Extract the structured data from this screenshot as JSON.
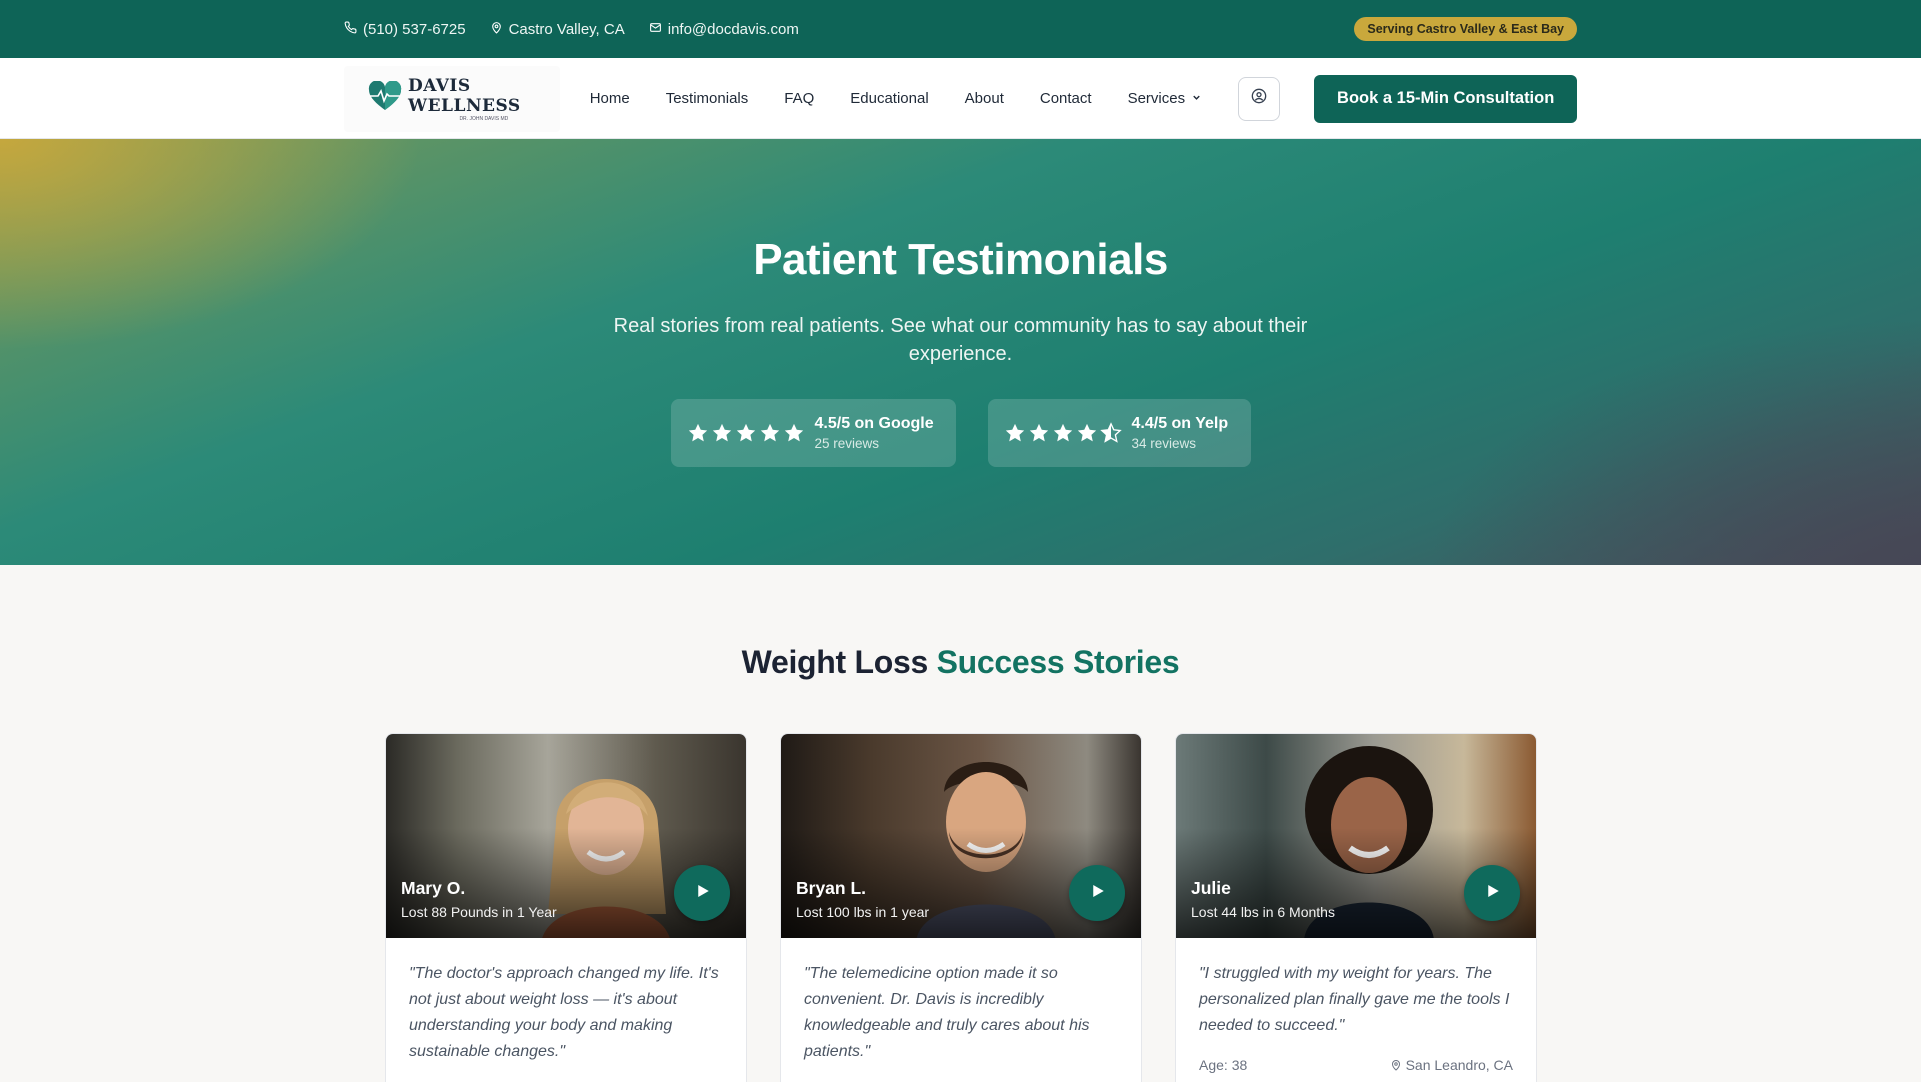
{
  "topbar": {
    "phone": "(510) 537-6725",
    "location": "Castro Valley, CA",
    "email": "info@docdavis.com",
    "badge": "Serving Castro Valley & East Bay"
  },
  "nav": {
    "logo_text": "DAVIS WELLNESS",
    "logo_sub": "DR. JOHN DAVIS MD",
    "items": [
      "Home",
      "Testimonials",
      "FAQ",
      "Educational",
      "About",
      "Contact",
      "Services"
    ],
    "cta": "Book a 15-Min Consultation"
  },
  "hero": {
    "title": "Patient Testimonials",
    "subtitle": "Real stories from real patients. See what our community has to say about their experience.",
    "ratings": [
      {
        "title": "4.5/5 on Google",
        "sub": "25 reviews",
        "stars": 5
      },
      {
        "title": "4.4/5 on Yelp",
        "sub": "34 reviews",
        "stars": 4.5
      }
    ]
  },
  "section": {
    "title_main": "Weight Loss",
    "title_accent": "Success Stories"
  },
  "testimonials": [
    {
      "name": "Mary O.",
      "result": "Lost 88 Pounds in 1 Year",
      "quote": "\"The doctor's approach changed my life. It's not just about weight loss — it's about understanding your body and making sustainable changes.\""
    },
    {
      "name": "Bryan L.",
      "result": "Lost 100 lbs in 1 year",
      "quote": "\"The telemedicine option made it so convenient. Dr. Davis is incredibly knowledgeable and truly cares about his patients.\""
    },
    {
      "name": "Julie",
      "result": "Lost 44 lbs in 6 Months",
      "quote": "\"I struggled with my weight for years. The personalized plan finally gave me the tools I needed to succeed.\"",
      "age": "Age: 38",
      "location": "San Leandro, CA"
    }
  ],
  "colors": {
    "primary": "#0e6457",
    "accent_gold": "#c9a83c",
    "accent_green": "#137362"
  },
  "icons": {
    "phone": "phone-icon",
    "location": "map-pin-icon",
    "email": "mail-icon",
    "user": "user-circle-icon",
    "play": "play-icon",
    "star": "star-icon"
  }
}
